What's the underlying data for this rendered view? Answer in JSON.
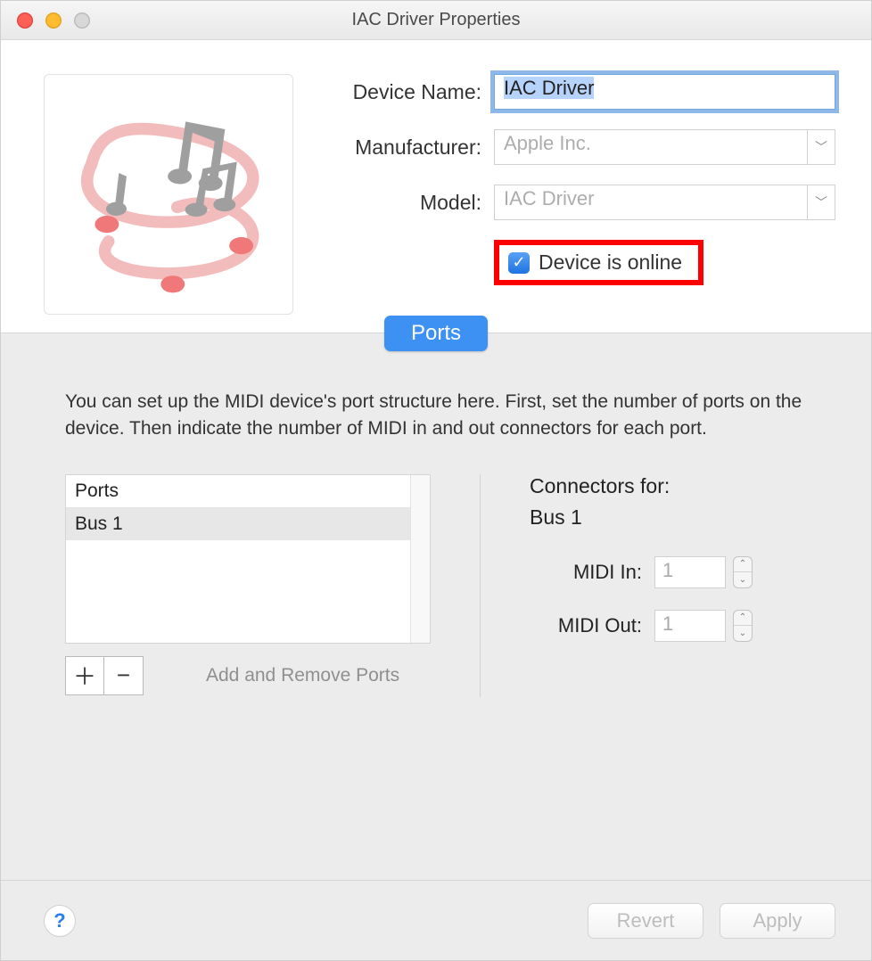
{
  "window": {
    "title": "IAC Driver Properties"
  },
  "form": {
    "device_name_label": "Device Name:",
    "device_name_value": "IAC Driver",
    "manufacturer_label": "Manufacturer:",
    "manufacturer_value": "Apple Inc.",
    "model_label": "Model:",
    "model_value": "IAC Driver",
    "online_label": "Device is online",
    "online_checked": true
  },
  "tab": {
    "label": "Ports"
  },
  "ports": {
    "description": "You can set up the MIDI device's port structure here. First, set the number of ports on the device. Then indicate the number of MIDI in and out connectors for each port.",
    "header": "Ports",
    "rows": [
      "Bus 1"
    ],
    "add_remove_label": "Add and Remove Ports"
  },
  "connectors": {
    "title": "Connectors for:",
    "target": "Bus 1",
    "midi_in_label": "MIDI In:",
    "midi_in_value": "1",
    "midi_out_label": "MIDI Out:",
    "midi_out_value": "1"
  },
  "footer": {
    "revert": "Revert",
    "apply": "Apply"
  }
}
